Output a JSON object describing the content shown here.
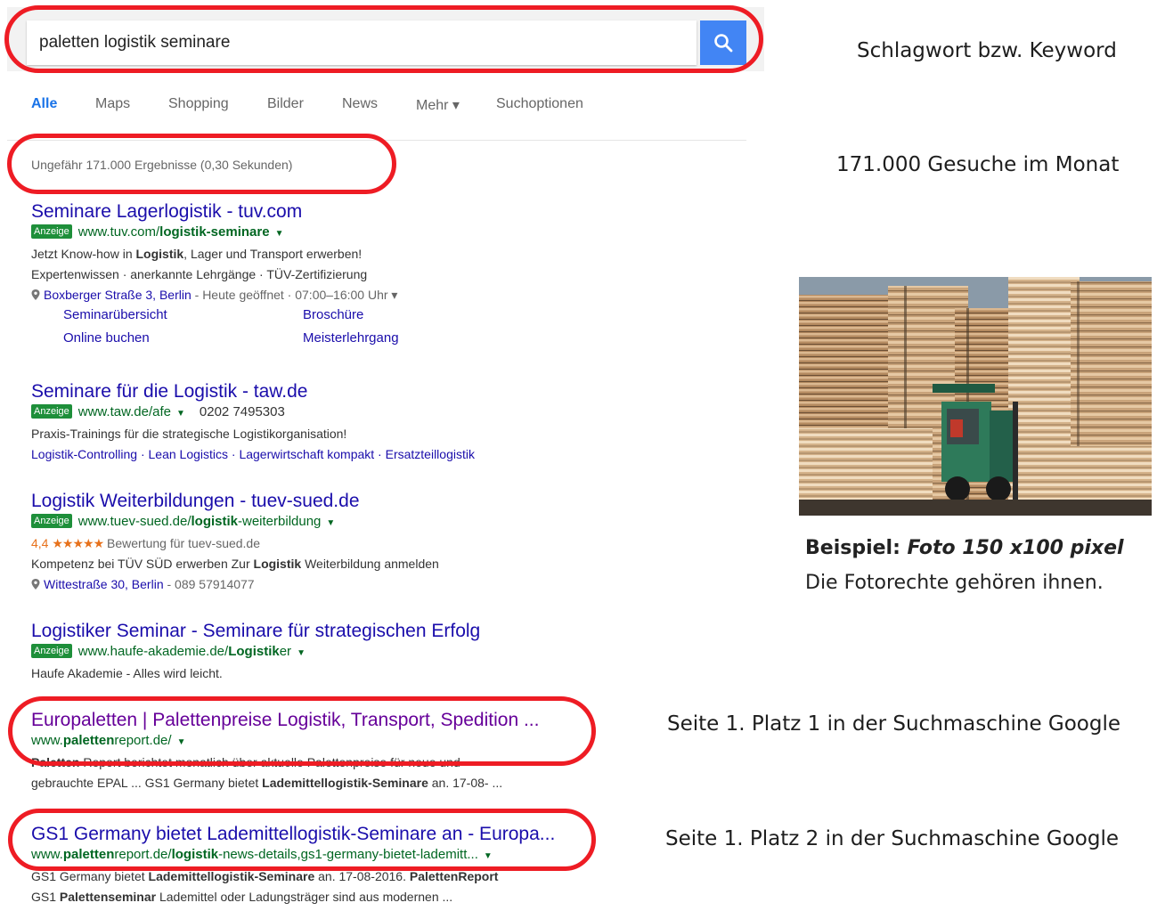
{
  "search": {
    "query": "paletten logistik seminare"
  },
  "tabs": [
    "Alle",
    "Maps",
    "Shopping",
    "Bilder",
    "News",
    "Mehr ▾",
    "Suchoptionen"
  ],
  "stats": "Ungefähr 171.000 Ergebnisse (0,30 Sekunden)",
  "ad_label": "Anzeige",
  "results": {
    "r1": {
      "title": "Seminare Lagerlogistik - tuv.com",
      "url_plain": "www.tuv.com/",
      "url_bold": "logistik-seminare",
      "line1_a": "Jetzt Know-how in ",
      "line1_b": "Logistik",
      "line1_c": ", Lager und Transport erwerben!",
      "line2": "Expertenwissen · anerkannte Lehrgänge · TÜV-Zertifizierung",
      "address": "Boxberger Straße 3, Berlin",
      "hours": " - Heute geöffnet · 07:00–16:00 Uhr ▾",
      "sitelinks": [
        "Seminarübersicht",
        "Broschüre",
        "Online buchen",
        "Meisterlehrgang"
      ]
    },
    "r2": {
      "title": "Seminare für die Logistik - taw.de",
      "url": "www.taw.de/afe",
      "phone": "0202 7495303",
      "line1": "Praxis-Trainings für die strategische Logistikorganisation!",
      "links": "Logistik-Controlling · Lean Logistics · Lagerwirtschaft kompakt · Ersatzteillogistik"
    },
    "r3": {
      "title": "Logistik Weiterbildungen - tuev-sued.de",
      "url_plain": "www.tuev-sued.de/",
      "url_bold": "logistik",
      "url_rest": "-weiterbildung",
      "rating": "4,4",
      "stars": "★★★★★",
      "rating_text": "Bewertung für tuev-sued.de",
      "line1_a": "Kompetenz bei TÜV SÜD erwerben Zur ",
      "line1_b": "Logistik",
      "line1_c": " Weiterbildung anmelden",
      "address": "Wittestraße 30, Berlin",
      "phone": " - 089 57914077"
    },
    "r4": {
      "title": "Logistiker Seminar - Seminare für strategischen Erfolg",
      "url_plain": "www.haufe-akademie.de/",
      "url_bold": "Logistik",
      "url_rest": "er",
      "line1": "Haufe Akademie - Alles wird leicht."
    },
    "r5": {
      "title": "Europaletten | Palettenpreise Logistik, Transport, Spedition ...",
      "url_plain": "www.",
      "url_bold": "paletten",
      "url_rest": "report.de/",
      "line1_a": "Paletten",
      "line1_b": " Report berichtet monatlich über aktuelle Palettenpreise für neue und",
      "line2_a": "gebrauchte EPAL ... GS1 Germany bietet ",
      "line2_b": "Lademittellogistik-Seminare",
      "line2_c": " an. 17-08- ..."
    },
    "r6": {
      "title": "GS1 Germany bietet Lademittellogistik-Seminare an - Europa...",
      "url_plain": "www.",
      "url_bold1": "paletten",
      "url_mid": "report.de/",
      "url_bold2": "logistik",
      "url_rest": "-news-details,gs1-germany-bietet-lademitt...",
      "line1_a": "GS1 Germany bietet ",
      "line1_b": "Lademittellogistik-Seminare",
      "line1_c": " an. 17-08-2016. ",
      "line1_d": "PalettenReport",
      "line2_a": "GS1 ",
      "line2_b": "Palettenseminar",
      "line2_c": " Lademittel oder Ladungsträger sind aus modernen ..."
    }
  },
  "notes": {
    "keyword": "Schlagwort bzw. Keyword",
    "searches": "171.000 Gesuche im Monat",
    "caption_bold": "Beispiel: ",
    "caption_italic": "Foto 150 x100 pixel",
    "caption2": "Die Fotorechte gehören ihnen.",
    "rank1": "Seite 1. Platz 1 in der Suchmaschine Google",
    "rank2": "Seite 1. Platz 2 in der Suchmaschine Google"
  },
  "colors": {
    "highlight": "#ee1c24",
    "link": "#1a0dab",
    "visited": "#660099",
    "url": "#006621",
    "search_button": "#4285f4"
  },
  "image": {
    "subject": "stacked wooden pallets with green forklift"
  }
}
